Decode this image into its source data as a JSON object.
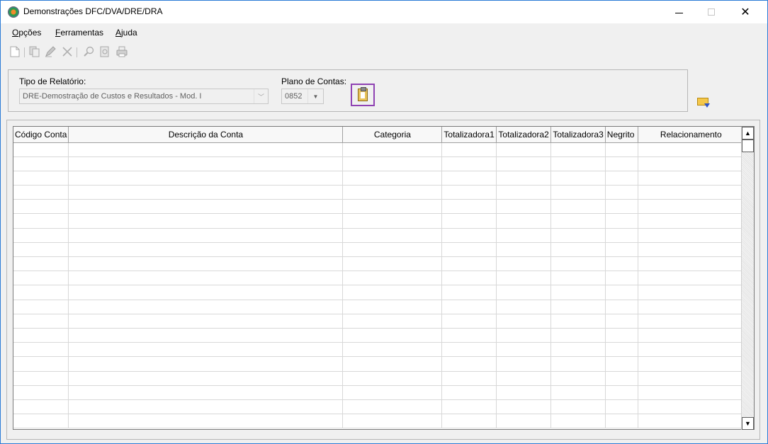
{
  "window": {
    "title": "Demonstrações DFC/DVA/DRE/DRA",
    "minimize": "—",
    "maximize": "☐",
    "close": "✕"
  },
  "menu": [
    {
      "accel": "O",
      "rest": "pções"
    },
    {
      "accel": "F",
      "rest": "erramentas"
    },
    {
      "accel": "A",
      "rest": "juda"
    }
  ],
  "toolbar": {
    "icons": [
      "new-document-icon",
      "copy-icon",
      "edit-pencil-icon",
      "delete-x-icon",
      "search-icon",
      "report-preview-icon",
      "print-icon"
    ]
  },
  "filters": {
    "report_type_label": "Tipo de Relatório:",
    "report_type_value": "DRE-Demostração de Custos e Resultados - Mod. I",
    "chart_of_accounts_label": "Plano de Contas:",
    "chart_of_accounts_value": "0852",
    "paste_icon": "clipboard-paste-icon",
    "folder_icon": "open-folder-filter-icon"
  },
  "grid": {
    "columns": [
      {
        "label": "Código Conta",
        "align": "left"
      },
      {
        "label": "Descrição da Conta",
        "align": "center"
      },
      {
        "label": "Categoria",
        "align": "center"
      },
      {
        "label": "Totalizadora1",
        "align": "left"
      },
      {
        "label": "Totalizadora2",
        "align": "left"
      },
      {
        "label": "Totalizadora3",
        "align": "left"
      },
      {
        "label": "Negrito",
        "align": "left"
      },
      {
        "label": "Relacionamento",
        "align": "center"
      }
    ],
    "empty_rows": 20,
    "scroll_up": "▲",
    "scroll_down": "▼"
  }
}
